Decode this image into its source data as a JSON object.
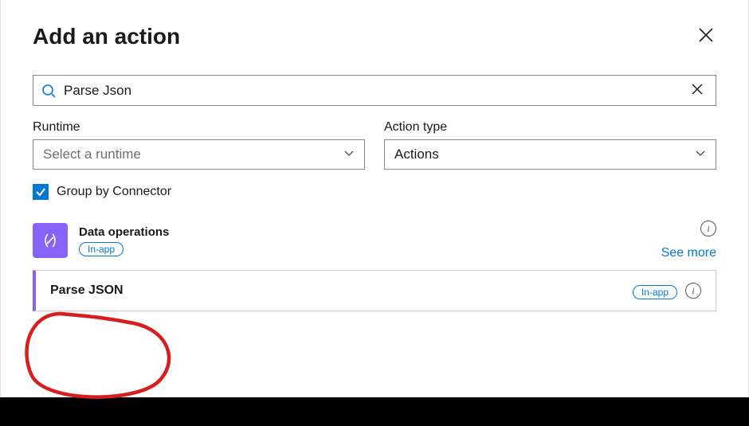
{
  "header": {
    "title": "Add an action"
  },
  "search": {
    "value": "Parse Json"
  },
  "filters": {
    "runtime": {
      "label": "Runtime",
      "placeholder": "Select a runtime"
    },
    "actionType": {
      "label": "Action type",
      "value": "Actions"
    }
  },
  "groupBy": {
    "label": "Group by Connector",
    "checked": true
  },
  "connector": {
    "name": "Data operations",
    "badge": "In-app",
    "seeMore": "See more"
  },
  "actions": [
    {
      "name": "Parse JSON",
      "badge": "In-app"
    }
  ],
  "colors": {
    "accent": "#0078d4",
    "connectorIcon": "#8662f7"
  }
}
